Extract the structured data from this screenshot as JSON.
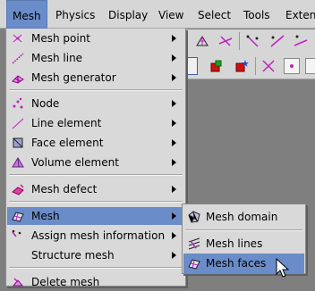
{
  "menubar": {
    "items": [
      "Mesh",
      "Physics",
      "Display",
      "View",
      "Select",
      "Tools",
      "Extens"
    ]
  },
  "main_menu": {
    "items": [
      {
        "label": "Mesh point",
        "icon": "mesh-point-icon",
        "submenu": true
      },
      {
        "label": "Mesh line",
        "icon": "mesh-line-icon",
        "submenu": true
      },
      {
        "label": "Mesh generator",
        "icon": "mesh-generator-icon",
        "submenu": true
      },
      {
        "label": "Node",
        "icon": "node-icon",
        "submenu": true
      },
      {
        "label": "Line element",
        "icon": "line-element-icon",
        "submenu": true
      },
      {
        "label": "Face element",
        "icon": "face-element-icon",
        "submenu": true
      },
      {
        "label": "Volume element",
        "icon": "volume-element-icon",
        "submenu": true
      },
      {
        "label": "Mesh defect",
        "icon": "mesh-defect-icon",
        "submenu": true
      },
      {
        "label": "Mesh",
        "icon": "mesh-icon",
        "submenu": true,
        "active": true
      },
      {
        "label": "Assign mesh information",
        "icon": "assign-mesh-icon",
        "submenu": true
      },
      {
        "label": "Structure mesh",
        "icon": "",
        "submenu": true
      },
      {
        "label": "Delete mesh",
        "icon": "delete-mesh-icon",
        "submenu": false
      }
    ]
  },
  "submenu": {
    "items": [
      {
        "label": "Mesh domain",
        "icon": "mesh-domain-icon"
      },
      {
        "label": "Mesh lines",
        "icon": "mesh-lines-icon"
      },
      {
        "label": "Mesh faces",
        "icon": "mesh-faces-icon",
        "active": true
      }
    ]
  },
  "colors": {
    "highlight": "#6a8cc8",
    "menu_bg": "#d9d9d9",
    "workspace": "#7f7f7f",
    "icon_magenta": "#c020c0"
  }
}
